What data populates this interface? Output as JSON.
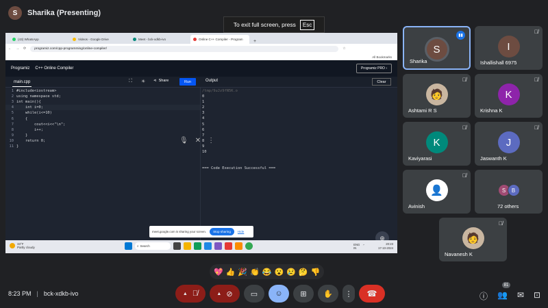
{
  "presenter": {
    "initial": "S",
    "label": "Sharika (Presenting)"
  },
  "fullscreen": {
    "hint": "To exit full screen, press",
    "key": "Esc"
  },
  "browser": {
    "tabs": [
      "(43) WhatsApp",
      "Videos - Google Drive",
      "Meet - bck-xdkb-ivo",
      "Online C++ Compiler - Program"
    ],
    "url": "programiz.com/cpp-programming/online-compiler/",
    "bookmarks": "All Bookmarks"
  },
  "compiler": {
    "brand_logo": "Programiz",
    "brand_title": "C++ Online Compiler",
    "pro_button": "Programiz PRO ›",
    "file_tab": "main.cpp",
    "share": "Share",
    "run": "Run",
    "output_label": "Output",
    "clear": "Clear",
    "code": [
      "#include<iostream>",
      "using namespace std;",
      "int main(){",
      "    int i=0;",
      "    while(i<=10)",
      "    {",
      "        cout<<i<<\"\\n\";",
      "        i++;",
      "    }",
      "    return 0;",
      "}"
    ],
    "line_numbers": [
      "1",
      "2",
      "3",
      "4",
      "5",
      "6",
      "7",
      "8",
      "9",
      "10",
      "11"
    ],
    "output_tmp": "/tmp/9uJz9fN5K.o",
    "output": [
      "0",
      "1",
      "2",
      "3",
      "4",
      "5",
      "6",
      "7",
      "8",
      "9",
      "10"
    ],
    "success": "=== Code Execution Successful ==="
  },
  "sharebar": {
    "text": "meet.google.com is sharing your screen.",
    "stop": "Stop sharing",
    "hide": "Hide"
  },
  "taskbar": {
    "temp": "33°F",
    "weather": "Partly cloudy",
    "search": "Search",
    "lang": "ENG\nIN",
    "time": "20:23",
    "date": "17-10-2024"
  },
  "participants": [
    {
      "id": "sharika",
      "name": "Sharika",
      "initial": "S",
      "color": "#6d4c41"
    },
    {
      "id": "ishallishall",
      "name": "Ishallishall 6975",
      "initial": "I",
      "color": "#6d4c41"
    },
    {
      "id": "ashtami",
      "name": "Ashtami R S",
      "initial": "",
      "color": "#c9b6a0"
    },
    {
      "id": "krishna",
      "name": "Krishna K",
      "initial": "K",
      "color": "#8e24aa"
    },
    {
      "id": "kaviyarasi",
      "name": "Kaviyarasi",
      "initial": "K",
      "color": "#00897b"
    },
    {
      "id": "jaswanth",
      "name": "Jaswanth K",
      "initial": "J",
      "color": "#5c6bc0"
    },
    {
      "id": "avinish",
      "name": "Avinish",
      "initial": "",
      "color": "#ffffff"
    },
    {
      "id": "others",
      "name": "72 others",
      "initial": "",
      "color": ""
    },
    {
      "id": "navanesh",
      "name": "Navanesh K",
      "initial": "",
      "color": "#c9b6a0"
    }
  ],
  "others_stack": [
    {
      "initial": "S",
      "color": "#a04b73"
    },
    {
      "initial": "B",
      "color": "#5c6bc0"
    }
  ],
  "reactions": [
    "💖",
    "👍",
    "🎉",
    "👏",
    "😂",
    "😮",
    "😢",
    "🤔",
    "👎"
  ],
  "meeting": {
    "time": "8:23 PM",
    "code": "bck-xdkb-ivo",
    "people_count": "81"
  }
}
